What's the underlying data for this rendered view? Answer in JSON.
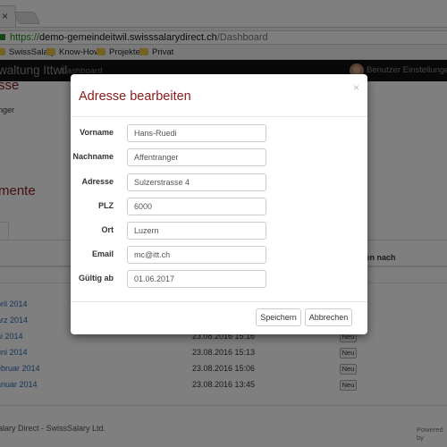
{
  "browser": {
    "tab_close": "×",
    "url_scheme": "https://",
    "url_host": "demo-gemeindeitwil.swisssalarydirect.ch",
    "url_path": "/Dashboard",
    "bookmarks": [
      "SwissSalary",
      "Know-How",
      "Projekte",
      "Privat"
    ]
  },
  "navbar": {
    "brand": "waltung Ittwil",
    "dashboard_link": "Dashboard",
    "user_menu": "Benutzer Einstellungen ▾"
  },
  "page": {
    "heading_top": "sse",
    "name_partial": "nger",
    "heading_docs": "mente",
    "col_header": "eben nach",
    "rows": [
      {
        "date": "pril 2014",
        "time": "",
        "badge": ""
      },
      {
        "date": "ärz 2014",
        "time": "",
        "badge": ""
      },
      {
        "date": "ai 2014",
        "time": "23.08.2016 15:16",
        "badge": "Neu"
      },
      {
        "date": "uni 2014",
        "time": "23.08.2016 15:13",
        "badge": "Neu"
      },
      {
        "date": "ebruar 2014",
        "time": "23.08.2016 15:06",
        "badge": "Neu"
      },
      {
        "date": "anuar 2014",
        "time": "23.08.2016 13:45",
        "badge": "Neu"
      }
    ],
    "footer": "alary Direct - SwissSalary Ltd.",
    "powered": "Powered by"
  },
  "modal": {
    "title": "Adresse bearbeiten",
    "close": "×",
    "fields": [
      {
        "label": "Vorname",
        "value": "Hans-Ruedi"
      },
      {
        "label": "Nachname",
        "value": "Affentranger"
      },
      {
        "label": "Adresse",
        "value": "Sulzerstrasse 4"
      },
      {
        "label": "PLZ",
        "value": "6000"
      },
      {
        "label": "Ort",
        "value": "Luzern"
      },
      {
        "label": "Email",
        "value": "mc@itt.ch"
      },
      {
        "label": "Gültig ab",
        "value": "01.06.2017"
      }
    ],
    "save_label": "Speichern",
    "cancel_label": "Abbrechen"
  }
}
